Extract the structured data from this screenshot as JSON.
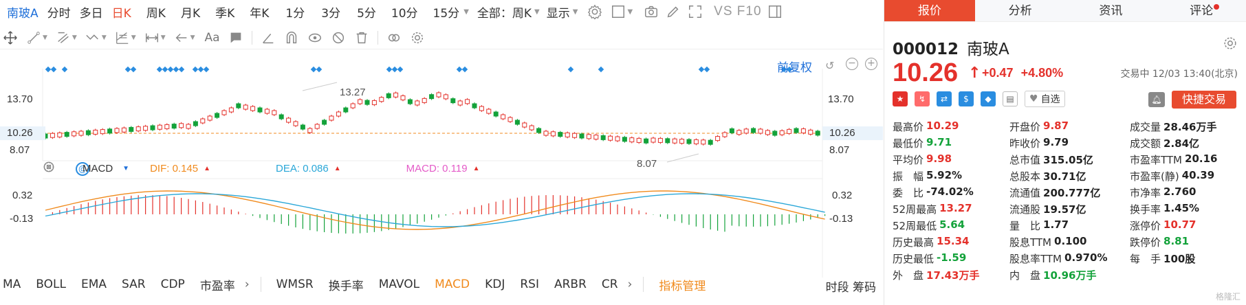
{
  "period_bar": {
    "stock_name": "南玻A",
    "items": [
      "分时",
      "多日",
      "日K",
      "周K",
      "月K",
      "季K",
      "年K",
      "1分",
      "3分",
      "5分",
      "10分",
      "15分"
    ],
    "active": "日K",
    "mode_select": "全部：周K",
    "display_select": "显示",
    "vs_label": "VS F10"
  },
  "draw_bar": {
    "text_tool": "Aa"
  },
  "chart": {
    "fuquan": "前复权",
    "y_labels_left": [
      "13.70",
      "10.26",
      "8.07"
    ],
    "y_labels_right": [
      "13.70",
      "10.26",
      "8.07"
    ],
    "current_price_tag": "10.26",
    "high_annotation": "13.27",
    "low_annotation": "8.07",
    "macd_y_labels": [
      "0.32",
      "-0.13"
    ]
  },
  "macd_legend": {
    "name": "MACD",
    "dif": "DIF: 0.145",
    "dea": "DEA: 0.086",
    "macd": "MACD: 0.119"
  },
  "indicator_bar": {
    "items": [
      "MA",
      "BOLL",
      "EMA",
      "SAR",
      "CDP",
      "市盈率",
      "WMSR",
      "换手率",
      "MAVOL",
      "MACD",
      "KDJ",
      "RSI",
      "ARBR",
      "CR",
      "指标管理"
    ],
    "active": "MACD",
    "right_tabs": "时段 筹码"
  },
  "quote_panel": {
    "tabs": [
      "报价",
      "分析",
      "资讯",
      "评论"
    ],
    "code": "000012",
    "name": "南玻A",
    "price": "10.26",
    "change": "+0.47",
    "change_pct": "+4.80%",
    "trade_time": "交易中 12/03 13:40(北京)",
    "favorite_label": "自选",
    "quick_trade": "快捷交易",
    "colors": {
      "up": "#e4312b",
      "down": "#13a23a",
      "accent": "#e84b2f"
    },
    "rows": [
      [
        [
          "最高价",
          "10.29",
          "red"
        ],
        [
          "开盘价",
          "9.87",
          "red"
        ],
        [
          "成交量",
          "28.46万手",
          ""
        ]
      ],
      [
        [
          "最低价",
          "9.71",
          "green"
        ],
        [
          "昨收价",
          "9.79",
          ""
        ],
        [
          "成交额",
          "2.84亿",
          ""
        ]
      ],
      [
        [
          "平均价",
          "9.98",
          "red"
        ],
        [
          "总市值",
          "315.05亿",
          ""
        ],
        [
          "市盈率TTM",
          "20.16",
          ""
        ]
      ],
      [
        [
          "振　幅",
          "5.92%",
          ""
        ],
        [
          "总股本",
          "30.71亿",
          ""
        ],
        [
          "市盈率(静)",
          "40.39",
          ""
        ]
      ],
      [
        [
          "委　比",
          "-74.02%",
          ""
        ],
        [
          "流通值",
          "200.777亿",
          ""
        ],
        [
          "市净率",
          "2.760",
          ""
        ]
      ],
      [
        [
          "52周最高",
          "13.27",
          "red"
        ],
        [
          "流通股",
          "19.57亿",
          ""
        ],
        [
          "换手率",
          "1.45%",
          ""
        ]
      ],
      [
        [
          "52周最低",
          "5.64",
          "green"
        ],
        [
          "量　比",
          "1.77",
          ""
        ],
        [
          "涨停价",
          "10.77",
          "red"
        ]
      ],
      [
        [
          "历史最高",
          "15.34",
          "red"
        ],
        [
          "股息TTM",
          "0.100",
          ""
        ],
        [
          "跌停价",
          "8.81",
          "green"
        ]
      ],
      [
        [
          "历史最低",
          "-1.59",
          "green"
        ],
        [
          "股息率TTM",
          "0.970%",
          ""
        ],
        [
          "每　手",
          "100股",
          ""
        ]
      ],
      [
        [
          "外　盘",
          "17.43万手",
          "red"
        ],
        [
          "内　盘",
          "10.96万手",
          "green"
        ],
        [
          "",
          "",
          ""
        ]
      ]
    ],
    "watermark": "格隆汇"
  }
}
